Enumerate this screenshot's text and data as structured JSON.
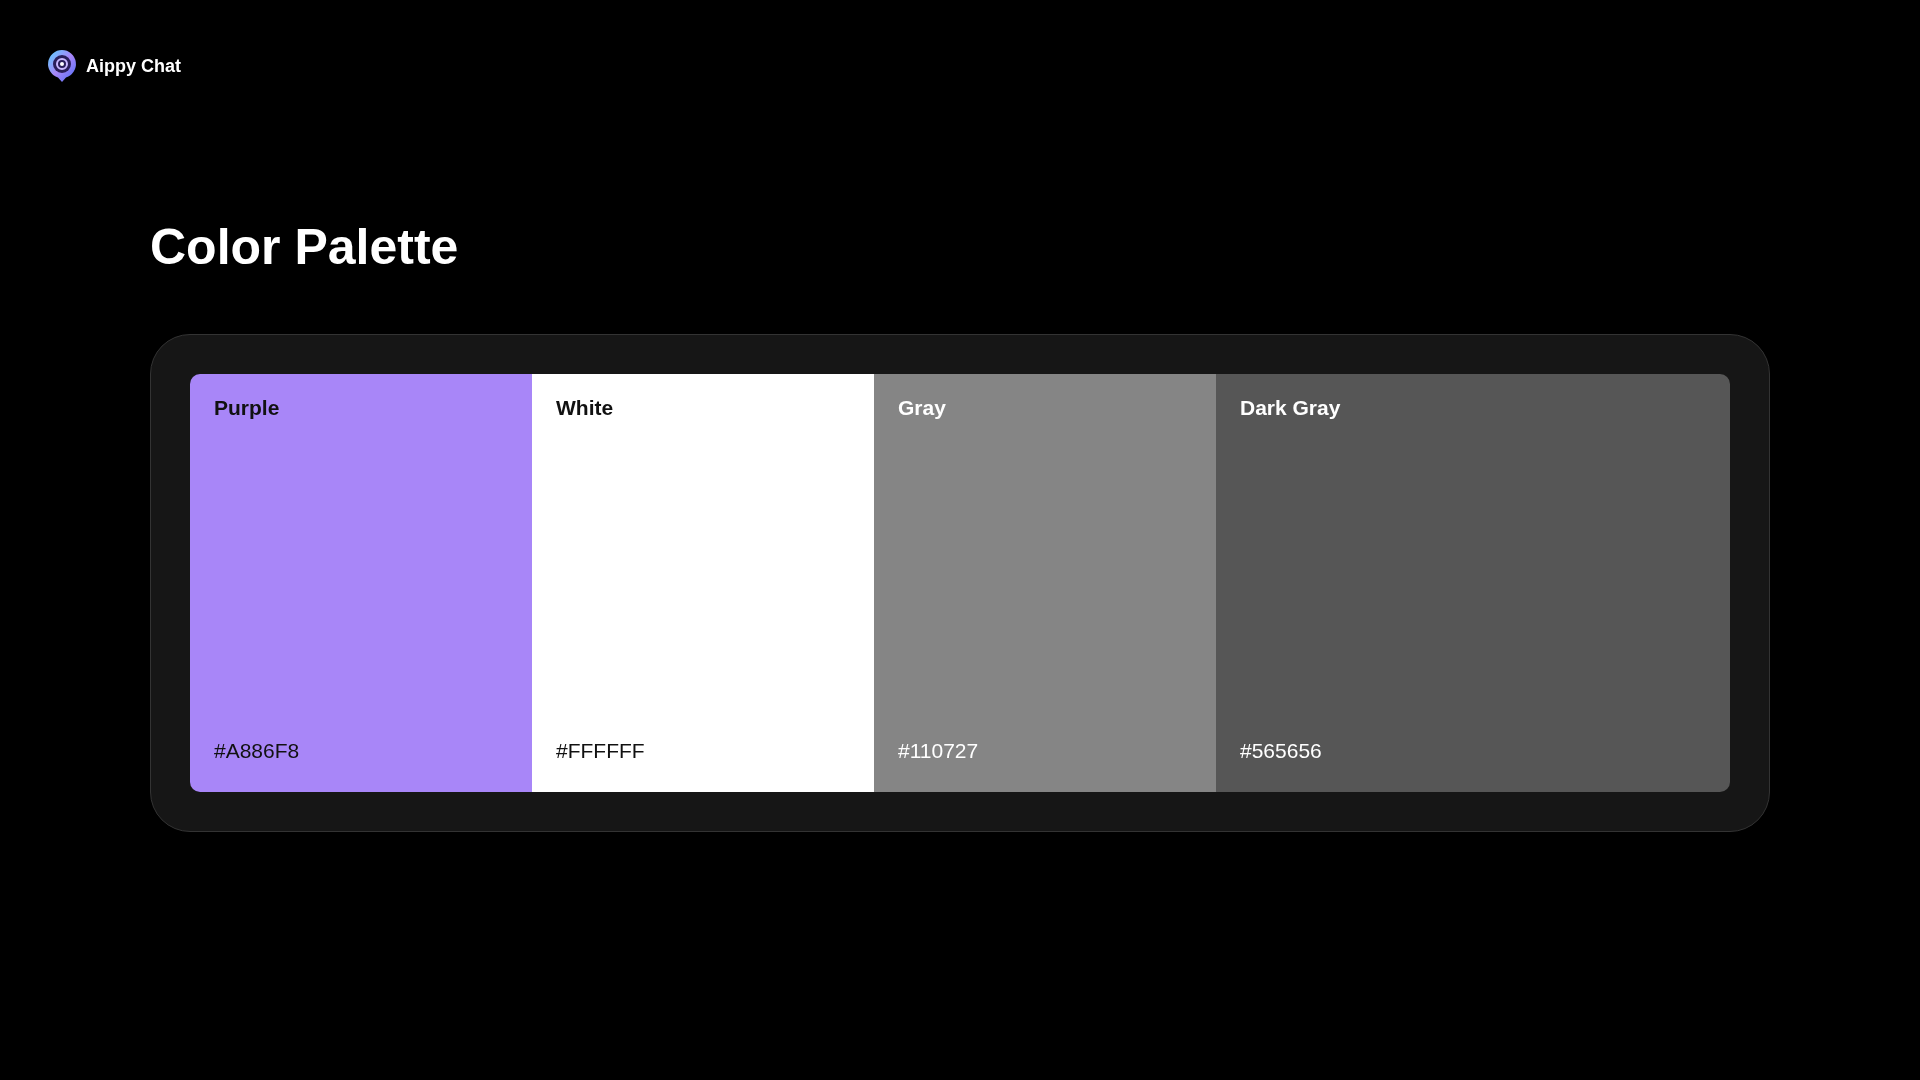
{
  "brand": {
    "name": "Aippy Chat"
  },
  "title": "Color Palette",
  "swatches": [
    {
      "name": "Purple",
      "hex": "#A886F8",
      "color": "#a886f8"
    },
    {
      "name": "White",
      "hex": "#FFFFFF",
      "color": "#ffffff"
    },
    {
      "name": "Gray",
      "hex": "#110727",
      "color": "#858585"
    },
    {
      "name": "Dark Gray",
      "hex": "#565656",
      "color": "#565656"
    }
  ]
}
